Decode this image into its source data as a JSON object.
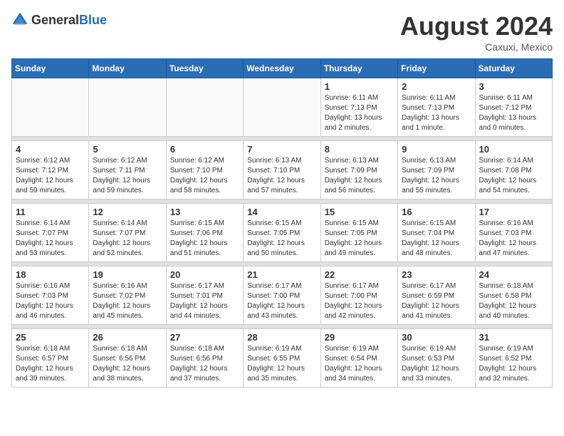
{
  "header": {
    "logo_general": "General",
    "logo_blue": "Blue",
    "title": "August 2024",
    "location": "Caxuxi, Mexico"
  },
  "days_of_week": [
    "Sunday",
    "Monday",
    "Tuesday",
    "Wednesday",
    "Thursday",
    "Friday",
    "Saturday"
  ],
  "weeks": [
    [
      {
        "day": "",
        "info": ""
      },
      {
        "day": "",
        "info": ""
      },
      {
        "day": "",
        "info": ""
      },
      {
        "day": "",
        "info": ""
      },
      {
        "day": "1",
        "info": "Sunrise: 6:11 AM\nSunset: 7:13 PM\nDaylight: 13 hours\nand 2 minutes."
      },
      {
        "day": "2",
        "info": "Sunrise: 6:11 AM\nSunset: 7:13 PM\nDaylight: 13 hours\nand 1 minute."
      },
      {
        "day": "3",
        "info": "Sunrise: 6:11 AM\nSunset: 7:12 PM\nDaylight: 13 hours\nand 0 minutes."
      }
    ],
    [
      {
        "day": "4",
        "info": "Sunrise: 6:12 AM\nSunset: 7:12 PM\nDaylight: 12 hours\nand 59 minutes."
      },
      {
        "day": "5",
        "info": "Sunrise: 6:12 AM\nSunset: 7:11 PM\nDaylight: 12 hours\nand 59 minutes."
      },
      {
        "day": "6",
        "info": "Sunrise: 6:12 AM\nSunset: 7:10 PM\nDaylight: 12 hours\nand 58 minutes."
      },
      {
        "day": "7",
        "info": "Sunrise: 6:13 AM\nSunset: 7:10 PM\nDaylight: 12 hours\nand 57 minutes."
      },
      {
        "day": "8",
        "info": "Sunrise: 6:13 AM\nSunset: 7:09 PM\nDaylight: 12 hours\nand 56 minutes."
      },
      {
        "day": "9",
        "info": "Sunrise: 6:13 AM\nSunset: 7:09 PM\nDaylight: 12 hours\nand 55 minutes."
      },
      {
        "day": "10",
        "info": "Sunrise: 6:14 AM\nSunset: 7:08 PM\nDaylight: 12 hours\nand 54 minutes."
      }
    ],
    [
      {
        "day": "11",
        "info": "Sunrise: 6:14 AM\nSunset: 7:07 PM\nDaylight: 12 hours\nand 53 minutes."
      },
      {
        "day": "12",
        "info": "Sunrise: 6:14 AM\nSunset: 7:07 PM\nDaylight: 12 hours\nand 52 minutes."
      },
      {
        "day": "13",
        "info": "Sunrise: 6:15 AM\nSunset: 7:06 PM\nDaylight: 12 hours\nand 51 minutes."
      },
      {
        "day": "14",
        "info": "Sunrise: 6:15 AM\nSunset: 7:05 PM\nDaylight: 12 hours\nand 50 minutes."
      },
      {
        "day": "15",
        "info": "Sunrise: 6:15 AM\nSunset: 7:05 PM\nDaylight: 12 hours\nand 49 minutes."
      },
      {
        "day": "16",
        "info": "Sunrise: 6:15 AM\nSunset: 7:04 PM\nDaylight: 12 hours\nand 48 minutes."
      },
      {
        "day": "17",
        "info": "Sunrise: 6:16 AM\nSunset: 7:03 PM\nDaylight: 12 hours\nand 47 minutes."
      }
    ],
    [
      {
        "day": "18",
        "info": "Sunrise: 6:16 AM\nSunset: 7:03 PM\nDaylight: 12 hours\nand 46 minutes."
      },
      {
        "day": "19",
        "info": "Sunrise: 6:16 AM\nSunset: 7:02 PM\nDaylight: 12 hours\nand 45 minutes."
      },
      {
        "day": "20",
        "info": "Sunrise: 6:17 AM\nSunset: 7:01 PM\nDaylight: 12 hours\nand 44 minutes."
      },
      {
        "day": "21",
        "info": "Sunrise: 6:17 AM\nSunset: 7:00 PM\nDaylight: 12 hours\nand 43 minutes."
      },
      {
        "day": "22",
        "info": "Sunrise: 6:17 AM\nSunset: 7:00 PM\nDaylight: 12 hours\nand 42 minutes."
      },
      {
        "day": "23",
        "info": "Sunrise: 6:17 AM\nSunset: 6:59 PM\nDaylight: 12 hours\nand 41 minutes."
      },
      {
        "day": "24",
        "info": "Sunrise: 6:18 AM\nSunset: 6:58 PM\nDaylight: 12 hours\nand 40 minutes."
      }
    ],
    [
      {
        "day": "25",
        "info": "Sunrise: 6:18 AM\nSunset: 6:57 PM\nDaylight: 12 hours\nand 39 minutes."
      },
      {
        "day": "26",
        "info": "Sunrise: 6:18 AM\nSunset: 6:56 PM\nDaylight: 12 hours\nand 38 minutes."
      },
      {
        "day": "27",
        "info": "Sunrise: 6:18 AM\nSunset: 6:56 PM\nDaylight: 12 hours\nand 37 minutes."
      },
      {
        "day": "28",
        "info": "Sunrise: 6:19 AM\nSunset: 6:55 PM\nDaylight: 12 hours\nand 35 minutes."
      },
      {
        "day": "29",
        "info": "Sunrise: 6:19 AM\nSunset: 6:54 PM\nDaylight: 12 hours\nand 34 minutes."
      },
      {
        "day": "30",
        "info": "Sunrise: 6:19 AM\nSunset: 6:53 PM\nDaylight: 12 hours\nand 33 minutes."
      },
      {
        "day": "31",
        "info": "Sunrise: 6:19 AM\nSunset: 6:52 PM\nDaylight: 12 hours\nand 32 minutes."
      }
    ]
  ]
}
